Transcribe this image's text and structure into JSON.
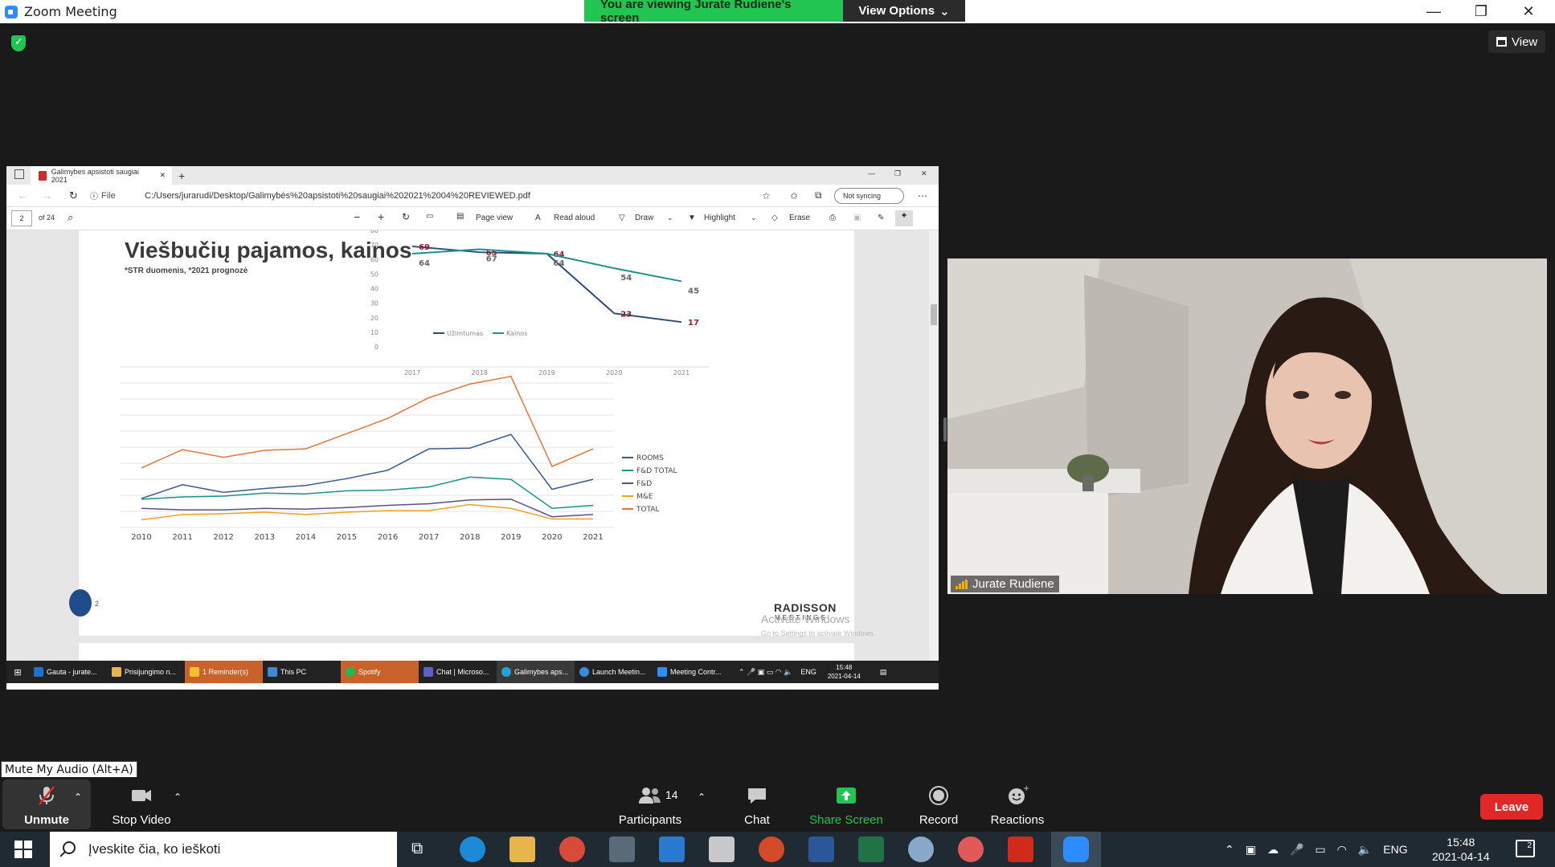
{
  "zoom": {
    "window_title": "Zoom Meeting",
    "viewing_banner": "You are viewing Jurate Rudiene's screen",
    "view_options": "View Options",
    "view_label": "View"
  },
  "browser": {
    "tab_title": "Galimybes apsistoti saugiai 2021",
    "file_label": "File",
    "address": "C:/Users/jurarudi/Desktop/Galimybės%20apsistoti%20saugiai%202021%2004%20REVIEWED.pdf",
    "sync": "Not syncing"
  },
  "pdf_toolbar": {
    "page_current": "2",
    "page_total": "of 24",
    "page_view": "Page view",
    "read_aloud": "Read aloud",
    "draw": "Draw",
    "highlight": "Highlight",
    "erase": "Erase"
  },
  "slide": {
    "title": "Viešbučių pajamos, kainos",
    "subtitle": "*STR duomenis, *2021 prognozė",
    "page_number": "2",
    "brand": "RADISSON",
    "brand_sub": "MEETINGS",
    "activate_title": "Activate Windows",
    "activate_sub": "Go to Settings to activate Windows."
  },
  "chart_data": [
    {
      "type": "line",
      "x": [
        "2017",
        "2018",
        "2019",
        "2020",
        "2021"
      ],
      "ylim": [
        0,
        80
      ],
      "yticks": [
        0,
        10,
        20,
        30,
        40,
        50,
        60,
        70,
        80
      ],
      "series": [
        {
          "name": "Užimtumas",
          "color": "#2d4a74",
          "values": [
            69,
            65,
            64,
            23,
            17
          ],
          "labels": [
            "69",
            "65",
            "64",
            "23",
            "17"
          ],
          "label_color": "#9b1b2a"
        },
        {
          "name": "Kainos",
          "color": "#1a9488",
          "values": [
            64,
            67,
            64,
            54,
            45
          ],
          "labels": [
            "64",
            "67",
            "64",
            "54",
            "45"
          ],
          "label_color": "#666666"
        }
      ]
    },
    {
      "type": "line",
      "x": [
        "2010",
        "2011",
        "2012",
        "2013",
        "2014",
        "2015",
        "2016",
        "2017",
        "2018",
        "2019",
        "2020",
        "2021"
      ],
      "ylim": [
        0,
        200
      ],
      "series": [
        {
          "name": "ROOMS",
          "color": "#3a5a8c",
          "values": [
            38,
            56,
            46,
            51,
            55,
            64,
            75,
            103,
            104,
            122,
            50,
            63
          ]
        },
        {
          "name": "F&D TOTAL",
          "color": "#1a9488",
          "values": [
            37,
            40,
            41,
            45,
            44,
            48,
            49,
            53,
            66,
            63,
            25,
            29
          ]
        },
        {
          "name": "F&D",
          "color": "#5a4f8a",
          "values": [
            25,
            23,
            23,
            25,
            24,
            26,
            29,
            31,
            36,
            37,
            14,
            17
          ]
        },
        {
          "name": "M&E",
          "color": "#f0a020",
          "values": [
            10,
            17,
            18,
            20,
            17,
            20,
            22,
            22,
            30,
            25,
            11,
            11
          ]
        },
        {
          "name": "TOTAL",
          "color": "#e0783a",
          "values": [
            78,
            102,
            92,
            101,
            103,
            123,
            143,
            170,
            188,
            198,
            80,
            103
          ]
        }
      ]
    }
  ],
  "inner_taskbar": [
    "Gauta - jurate...",
    "Prisijungimo n...",
    "1 Reminder(s)",
    "This PC",
    "Spotify",
    "Chat | Microso...",
    "Galimybes aps...",
    "Launch Meetin...",
    "Meeting Contr..."
  ],
  "inner_tray": {
    "lang": "ENG",
    "time": "15:48",
    "date": "2021-04-14"
  },
  "participant": {
    "name": "Jurate Rudiene"
  },
  "controls": {
    "tooltip": "Mute My Audio (Alt+A)",
    "unmute": "Unmute",
    "stop_video": "Stop Video",
    "participants": "Participants",
    "participants_count": "14",
    "chat": "Chat",
    "share_screen": "Share Screen",
    "record": "Record",
    "reactions": "Reactions",
    "leave": "Leave"
  },
  "taskbar": {
    "search_placeholder": "Įveskite čia, ko ieškoti",
    "lang": "ENG",
    "time": "15:48",
    "date": "2021-04-14",
    "notifications": "2"
  }
}
